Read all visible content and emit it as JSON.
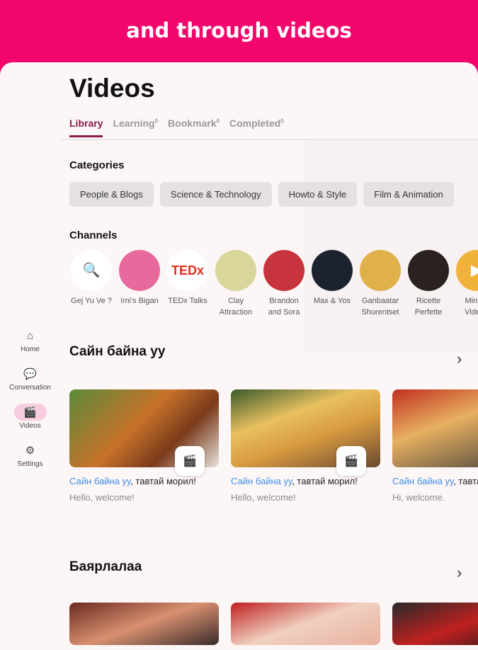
{
  "banner": "and through videos",
  "title": "Videos",
  "tabs": [
    {
      "label": "Library",
      "count": ""
    },
    {
      "label": "Learning",
      "count": "0"
    },
    {
      "label": "Bookmark",
      "count": "0"
    },
    {
      "label": "Completed",
      "count": "0"
    }
  ],
  "categories_title": "Categories",
  "categories": [
    "People & Blogs",
    "Science & Technology",
    "Howto & Style",
    "Film & Animation"
  ],
  "channels_title": "Channels",
  "channels": [
    {
      "name": "Gej Yu Ve ?",
      "color": "#ffffff",
      "glyph": "🔍"
    },
    {
      "name": "Imi's Bigan",
      "color": "#e86a9c",
      "glyph": ""
    },
    {
      "name": "TEDx Talks",
      "color": "#ffffff",
      "glyph": "TEDx"
    },
    {
      "name": "Clay Attraction",
      "color": "#d8d69a",
      "glyph": ""
    },
    {
      "name": "Brandon and Sora",
      "color": "#c8343e",
      "glyph": ""
    },
    {
      "name": "Max & Yos",
      "color": "#1d2230",
      "glyph": ""
    },
    {
      "name": "Ganbaatar Shurentset",
      "color": "#e0b04a",
      "glyph": ""
    },
    {
      "name": "Ricette Perfette",
      "color": "#2a221e",
      "glyph": ""
    },
    {
      "name": "Minute Videos",
      "color": "#f0b23a",
      "glyph": "▶"
    }
  ],
  "nav": [
    {
      "label": "Home",
      "icon": "⌂"
    },
    {
      "label": "Conversation",
      "icon": "💬"
    },
    {
      "label": "Videos",
      "icon": "🎬"
    },
    {
      "label": "Settings",
      "icon": "⚙"
    }
  ],
  "sections": [
    {
      "title": "Сайн байна уу",
      "cards": [
        {
          "highlight": "Сайн байна уу",
          "rest": ", тавтай морил!",
          "sub": "Hello, welcome!",
          "bg": "linear-gradient(135deg,#5b8a3a,#c8722a 45%,#7a3a1a 70%,#e8e4de)"
        },
        {
          "highlight": "Сайн байна уу",
          "rest": ", тавтай морил!",
          "sub": "Hello, welcome!",
          "bg": "linear-gradient(160deg,#3a5a2a,#e8c060 35%,#d89a40 60%,#6a4a30)"
        },
        {
          "highlight": "Сайн байна уу",
          "rest": ", тавтай морил!",
          "sub": "Hi, welcome.",
          "bg": "linear-gradient(160deg,#c03020,#e8b060 40%,#3a3a3a)"
        }
      ]
    },
    {
      "title": "Баярлалаа",
      "cards": [
        {
          "bg": "linear-gradient(160deg,#6a2a20,#d89070,#3a2a2a)"
        },
        {
          "bg": "linear-gradient(160deg,#c02020,#f0d0c0,#e8b0a0)"
        },
        {
          "bg": "linear-gradient(160deg,#2a2a2a,#c02020,#1a1a1a)"
        }
      ]
    }
  ]
}
